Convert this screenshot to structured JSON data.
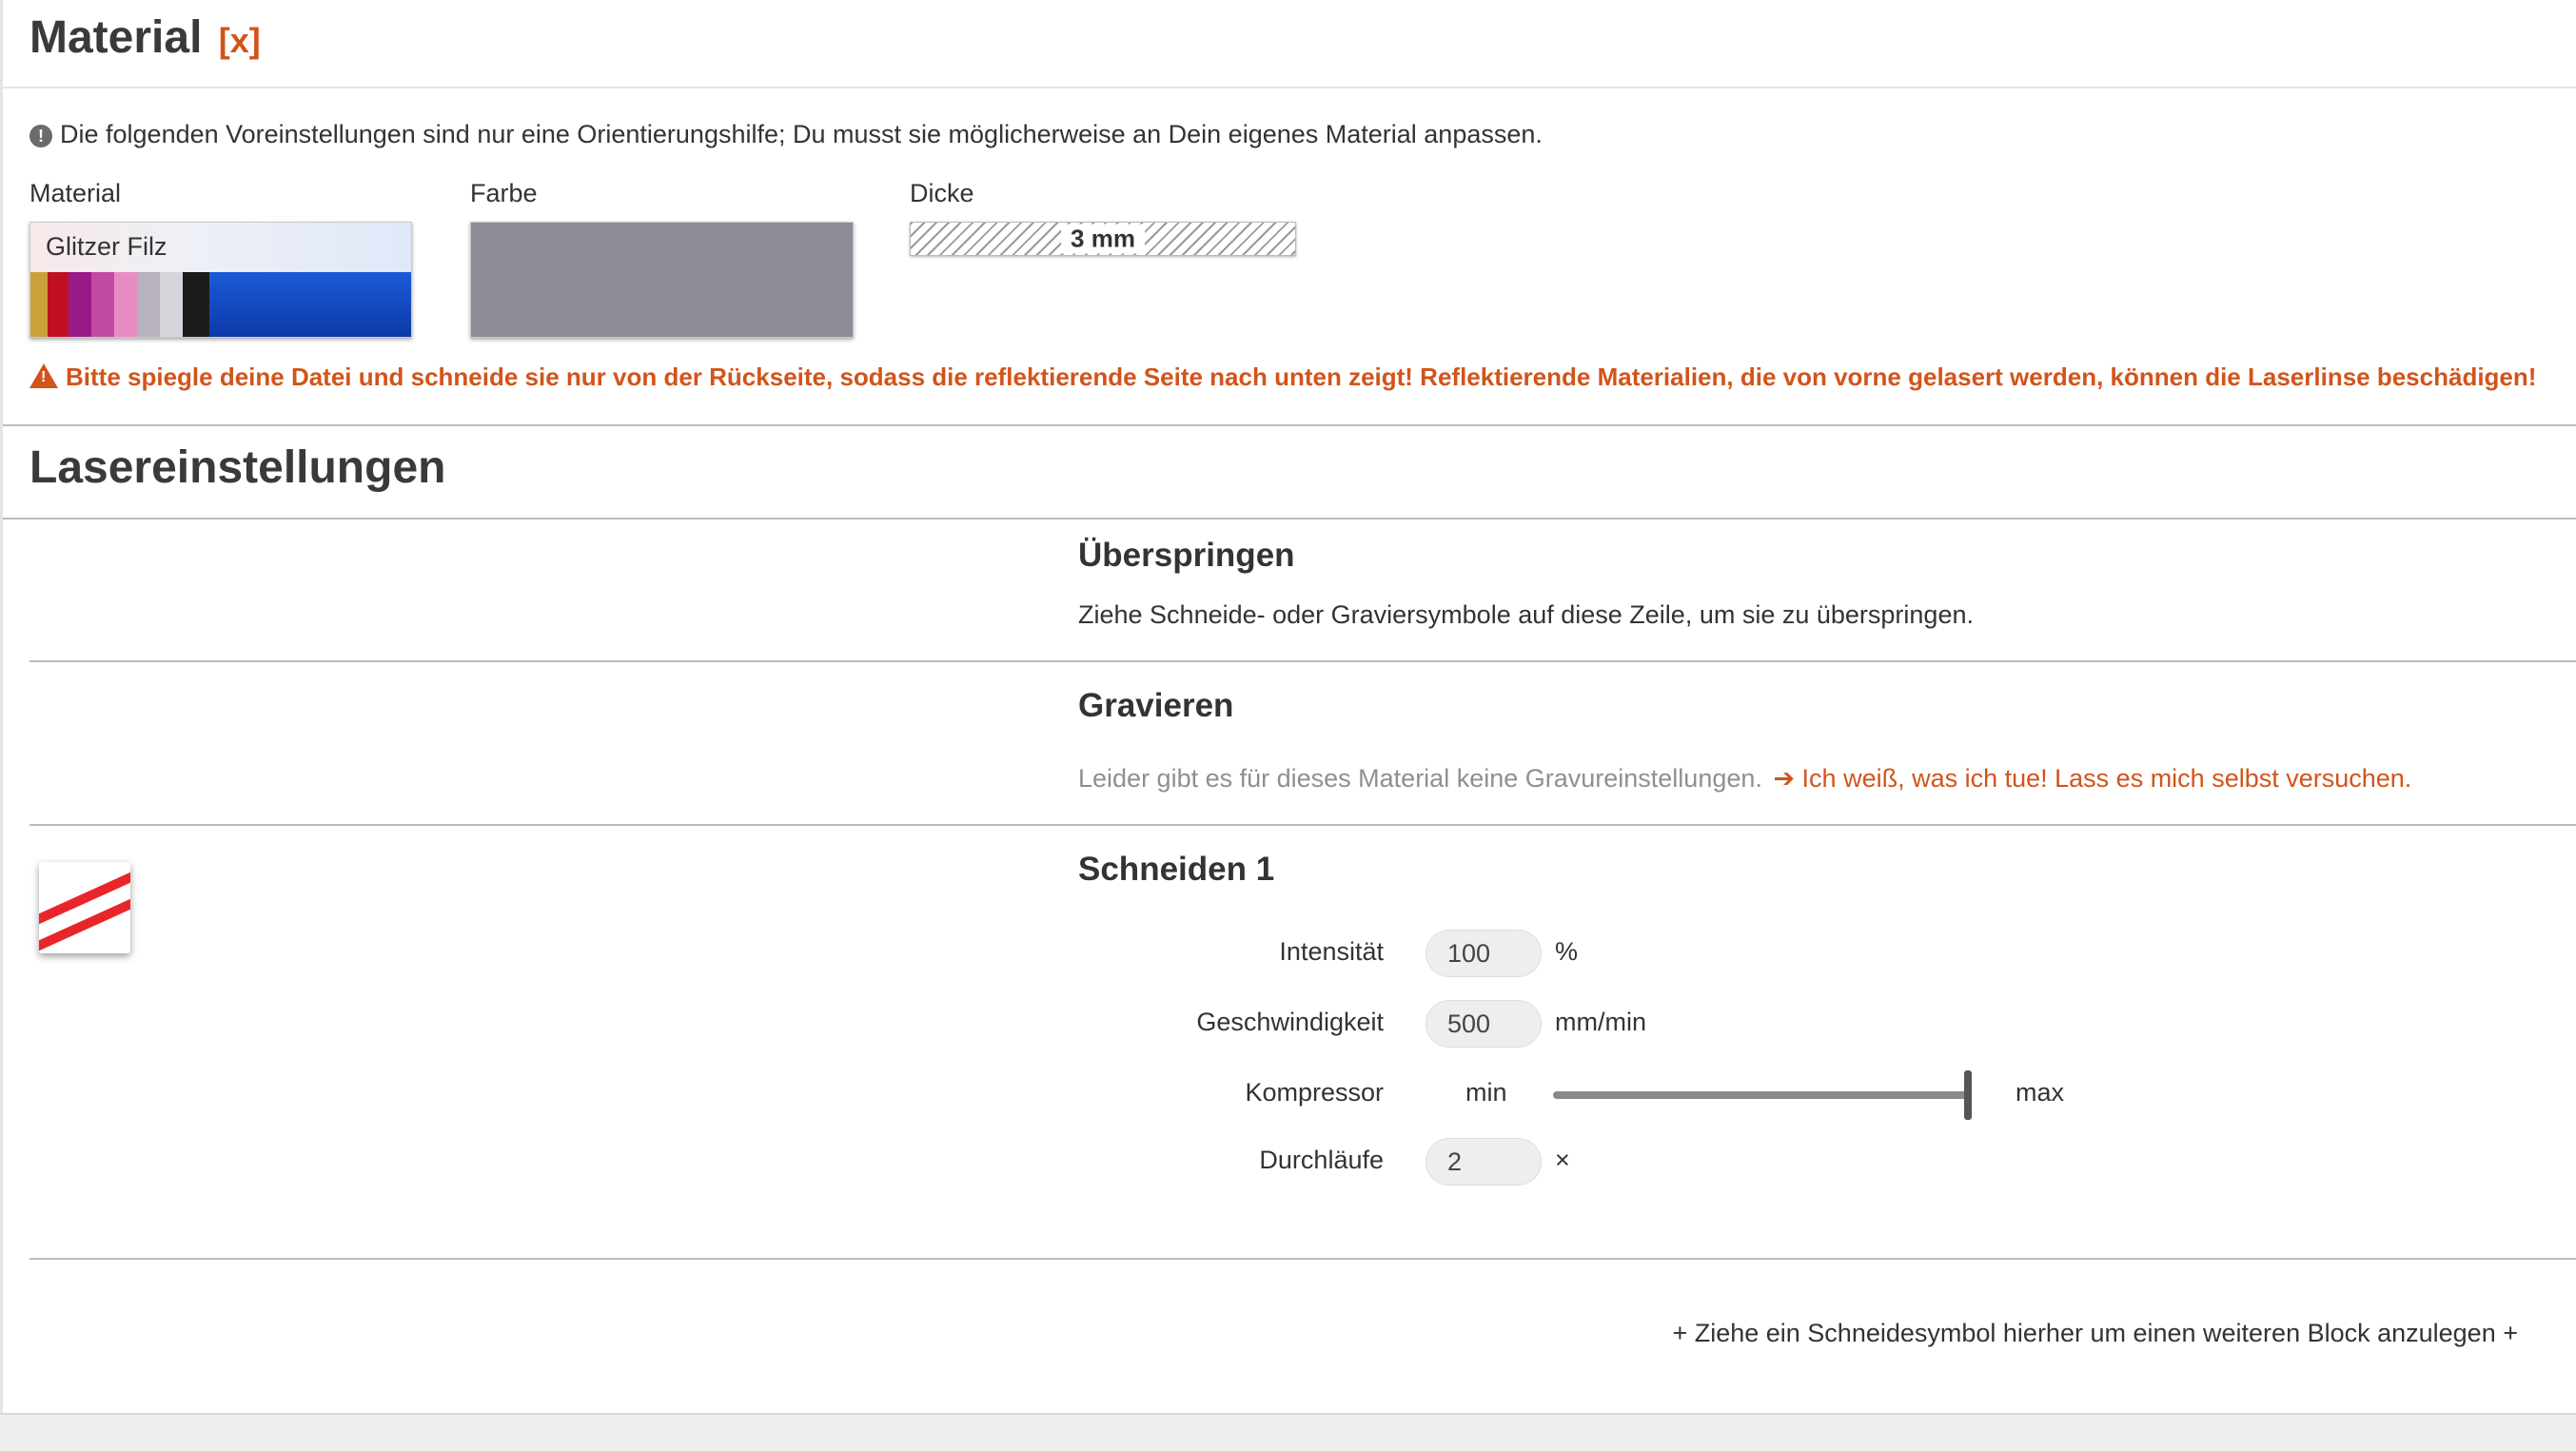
{
  "material_section": {
    "title": "Material",
    "close_label": "[x]",
    "info_text": "Die folgenden Voreinstellungen sind nur eine Orientierungshilfe; Du musst sie möglicherweise an Dein eigenes Material anpassen.",
    "material_label": "Material",
    "material_value": "Glitzer Filz",
    "color_label": "Farbe",
    "color_value": "#8e8b94",
    "thickness_label": "Dicke",
    "thickness_value": "3 mm",
    "warning_text": "Bitte spiegle deine Datei und schneide sie nur von der Rückseite, sodass die reflektierende Seite nach unten zeigt! Reflektierende Materialien, die von vorne gelasert werden, können die Laserlinse beschädigen!"
  },
  "laser_section": {
    "title": "Lasereinstellungen",
    "skip": {
      "title": "Überspringen",
      "description": "Ziehe Schneide- oder Graviersymbole auf diese Zeile, um sie zu überspringen."
    },
    "engrave": {
      "title": "Gravieren",
      "note": "Leider gibt es für dieses Material keine Gravureinstellungen.",
      "try_link": "Ich weiß, was ich tue! Lass es mich selbst versuchen."
    },
    "cut1": {
      "title": "Schneiden 1",
      "intensity_label": "Intensität",
      "intensity_value": "100",
      "intensity_unit": "%",
      "speed_label": "Geschwindigkeit",
      "speed_value": "500",
      "speed_unit": "mm/min",
      "compressor_label": "Kompressor",
      "compressor_min": "min",
      "compressor_max": "max",
      "compressor_level": 1.0,
      "passes_label": "Durchläufe",
      "passes_value": "2",
      "passes_unit": "×"
    },
    "add_block_hint": "+ Ziehe ein Schneidesymbol hierher um einen weiteren Block anzulegen +"
  },
  "colors": {
    "accent": "#d2541a",
    "cut_icon": "#e8262a"
  },
  "icons": [
    "info-circle-icon",
    "warning-triangle-icon",
    "arrow-right-icon",
    "cut-line-icon"
  ]
}
